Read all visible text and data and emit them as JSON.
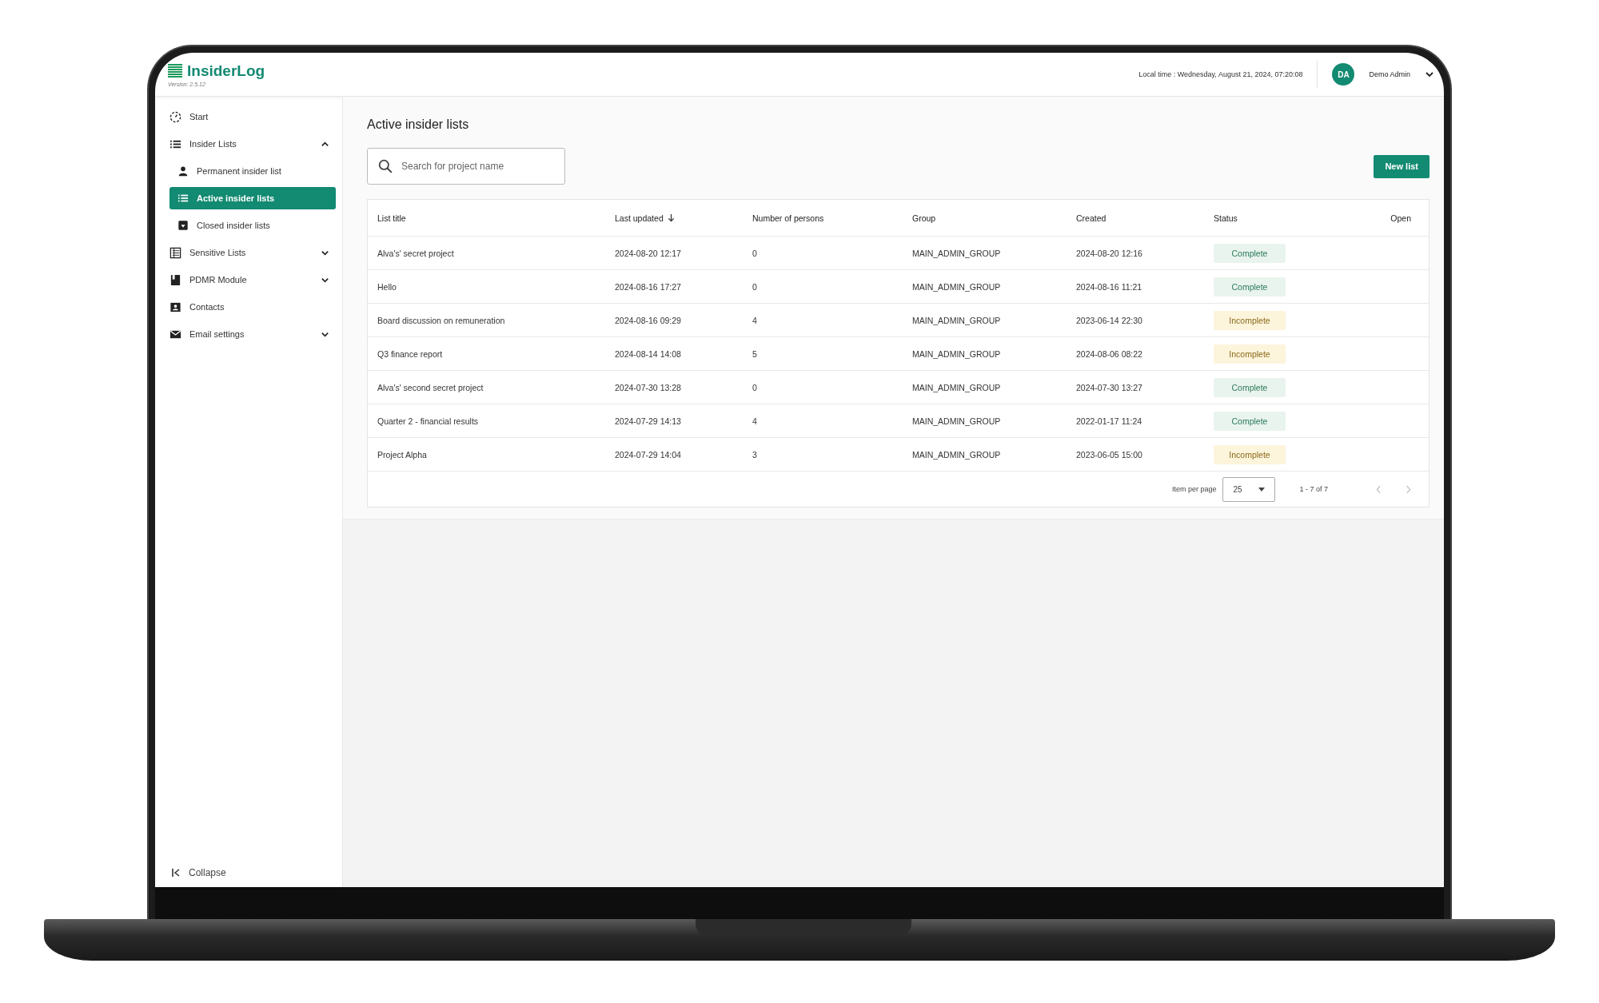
{
  "app": {
    "name": "InsiderLog",
    "version": "Version: 2.5.12"
  },
  "header": {
    "local_time": "Local time : Wednesday, August 21, 2024, 07:20:08",
    "avatar": "DA",
    "user": "Demo Admin"
  },
  "sidebar": {
    "items": [
      {
        "label": "Start"
      },
      {
        "label": "Insider Lists",
        "expanded": true,
        "children": [
          {
            "label": "Permanent insider list",
            "selected": false
          },
          {
            "label": "Active insider lists",
            "selected": true
          },
          {
            "label": "Closed insider lists",
            "selected": false
          }
        ]
      },
      {
        "label": "Sensitive Lists",
        "expanded": false
      },
      {
        "label": "PDMR Module",
        "expanded": false
      },
      {
        "label": "Contacts"
      },
      {
        "label": "Email settings",
        "expanded": false
      }
    ],
    "collapse": "Collapse"
  },
  "page": {
    "title": "Active insider lists",
    "search": {
      "placeholder": "Search for project name"
    },
    "new_button": "New list"
  },
  "table": {
    "columns": [
      {
        "label": "List title",
        "sorted": false
      },
      {
        "label": "Last updated",
        "sorted": true
      },
      {
        "label": "Number of persons",
        "sorted": false
      },
      {
        "label": "Group",
        "sorted": false
      },
      {
        "label": "Created",
        "sorted": false
      },
      {
        "label": "Status",
        "sorted": false
      },
      {
        "label": "Open",
        "sorted": false
      }
    ],
    "rows": [
      {
        "title": "Alva's' secret project",
        "updated": "2024-08-20 12:17",
        "persons": "0",
        "group": "MAIN_ADMIN_GROUP",
        "created": "2024-08-20 12:16",
        "status": "Complete",
        "kind": "complete"
      },
      {
        "title": "Hello",
        "updated": "2024-08-16 17:27",
        "persons": "0",
        "group": "MAIN_ADMIN_GROUP",
        "created": "2024-08-16 11:21",
        "status": "Complete",
        "kind": "complete"
      },
      {
        "title": "Board discussion on remuneration",
        "updated": "2024-08-16 09:29",
        "persons": "4",
        "group": "MAIN_ADMIN_GROUP",
        "created": "2023-06-14 22:30",
        "status": "Incomplete",
        "kind": "incomplete"
      },
      {
        "title": "Q3 finance report",
        "updated": "2024-08-14 14:08",
        "persons": "5",
        "group": "MAIN_ADMIN_GROUP",
        "created": "2024-08-06 08:22",
        "status": "Incomplete",
        "kind": "incomplete"
      },
      {
        "title": "Alva's' second secret project",
        "updated": "2024-07-30 13:28",
        "persons": "0",
        "group": "MAIN_ADMIN_GROUP",
        "created": "2024-07-30 13:27",
        "status": "Complete",
        "kind": "complete"
      },
      {
        "title": "Quarter 2 - financial results",
        "updated": "2024-07-29 14:13",
        "persons": "4",
        "group": "MAIN_ADMIN_GROUP",
        "created": "2022-01-17 11:24",
        "status": "Complete",
        "kind": "complete"
      },
      {
        "title": "Project Alpha",
        "updated": "2024-07-29 14:04",
        "persons": "3",
        "group": "MAIN_ADMIN_GROUP",
        "created": "2023-06-05 15:00",
        "status": "Incomplete",
        "kind": "incomplete"
      }
    ],
    "pagination": {
      "label": "Item per page",
      "per_page": "25",
      "range": "1 - 7 of 7"
    }
  }
}
